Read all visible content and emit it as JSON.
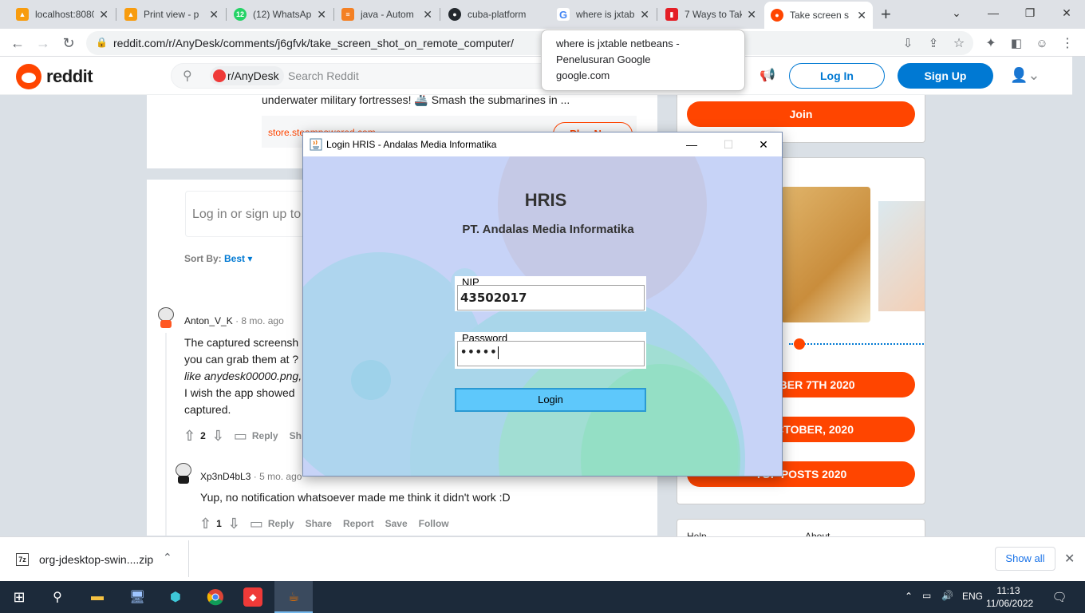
{
  "browser": {
    "tabs": [
      {
        "title": "localhost:8080",
        "favicon": "pma-icon",
        "fav_color": "#f89c0e"
      },
      {
        "title": "Print view - p",
        "favicon": "pma-icon",
        "fav_color": "#f89c0e"
      },
      {
        "title": "(12) WhatsApp",
        "favicon": "whatsapp-icon",
        "fav_color": "#25d366"
      },
      {
        "title": "java - Autom",
        "favicon": "stackoverflow-icon",
        "fav_color": "#f48024"
      },
      {
        "title": "cuba-platform",
        "favicon": "github-icon",
        "fav_color": "#24292e"
      },
      {
        "title": "where is jxtab",
        "favicon": "google-icon",
        "fav_color": "#4285f4"
      },
      {
        "title": "7 Ways to Tak",
        "favicon": "bookmark-icon",
        "fav_color": "#e41e26"
      },
      {
        "title": "Take screen s",
        "favicon": "reddit-icon",
        "fav_color": "#ff4500"
      }
    ],
    "active_tab": 7,
    "url": "reddit.com/r/AnyDesk/comments/j6gfvk/take_screen_shot_on_remote_computer/",
    "suggestion": {
      "line1": "where is jxtable netbeans -",
      "line2": "Penelusuran Google",
      "line3": "google.com"
    }
  },
  "reddit": {
    "logo_text": "reddit",
    "subreddit_chip": "r/AnyDesk",
    "search_placeholder": "Search Reddit",
    "login_label": "Log In",
    "signup_label": "Sign Up",
    "ad_text": "underwater military fortresses! 🚢 Smash the submarines in ...",
    "ad_link": "store.steampowered.com",
    "play_now": "Play Now",
    "login_prompt": "Log in or sign up to",
    "sort_label": "Sort By:",
    "sort_value": "Best",
    "comments": [
      {
        "author": "Anton_V_K",
        "age": "8 mo. ago",
        "lines": [
          "The captured screensh",
          "you can grab them at ?",
          "like anydesk00000.png,",
          "I wish the app showed",
          "captured."
        ],
        "votes": "2",
        "actions": [
          "Reply",
          "Sh"
        ]
      },
      {
        "author": "Xp3nD4bL3",
        "age": "5 mo. ago",
        "lines": [
          "Yup, no notification whatsoever made me think it didn't work :D"
        ],
        "votes": "1",
        "actions": [
          "Reply",
          "Share",
          "Report",
          "Save",
          "Follow"
        ]
      }
    ],
    "sidebar": {
      "join_label": "Join",
      "widget_buttons": [
        "OCTOBER 7TH 2020",
        "OF OCTOBER, 2020",
        "TOP POSTS 2020"
      ],
      "footer_links": [
        "Help",
        "About"
      ]
    }
  },
  "dialog": {
    "window_title": "Login HRIS - Andalas Media Informatika",
    "app_title": "HRIS",
    "company": "PT. Andalas Media Informatika",
    "nip_legend": "NIP",
    "nip_value": "43502017",
    "password_legend": "Password",
    "password_value": "•••••",
    "login_label": "Login"
  },
  "downloads": {
    "file_name": "org-jdesktop-swin....zip",
    "show_all": "Show all"
  },
  "taskbar": {
    "language": "ENG",
    "time": "11:13",
    "date": "11/06/2022"
  }
}
